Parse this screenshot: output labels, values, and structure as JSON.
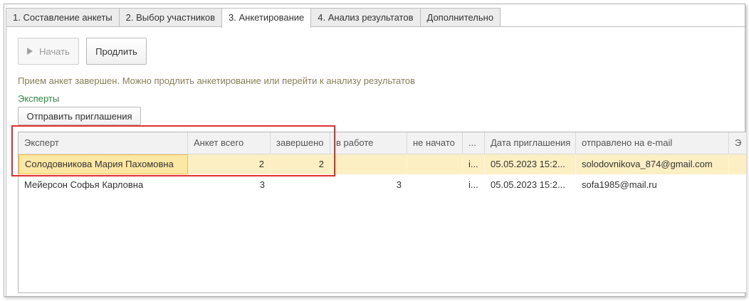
{
  "tabs": [
    {
      "label": "1. Составление анкеты"
    },
    {
      "label": "2. Выбор участников"
    },
    {
      "label": "3. Анкетирование"
    },
    {
      "label": "4. Анализ результатов"
    },
    {
      "label": "Дополнительно"
    }
  ],
  "toolbar": {
    "start_label": "Начать",
    "extend_label": "Продлить"
  },
  "status_text": "Прием анкет завершен. Можно продлить анкетирование или перейти к анализу результатов",
  "experts_label": "Эксперты",
  "send_invites_label": "Отправить приглашения",
  "table": {
    "columns": [
      "Эксперт",
      "Анкет всего",
      "завершено",
      "в работе",
      "не начато",
      "...",
      "Дата приглашения",
      "отправлено на e-mail",
      "Э"
    ],
    "rows": [
      {
        "cells": [
          "Солодовникова Мария Пахомовна",
          "2",
          "2",
          "",
          "",
          "i...",
          "05.05.2023 15:2...",
          "solodovnikova_874@gmail.com",
          ""
        ]
      },
      {
        "cells": [
          "Мейерсон Софья Карловна",
          "3",
          "",
          "3",
          "",
          "i...",
          "05.05.2023 15:2...",
          "sofa1985@mail.ru",
          ""
        ]
      }
    ]
  },
  "colors": {
    "selected_row": "#fbefc3",
    "highlight_border": "#e03030",
    "experts_green": "#2e8b3e",
    "status_text": "#8a7e57"
  }
}
